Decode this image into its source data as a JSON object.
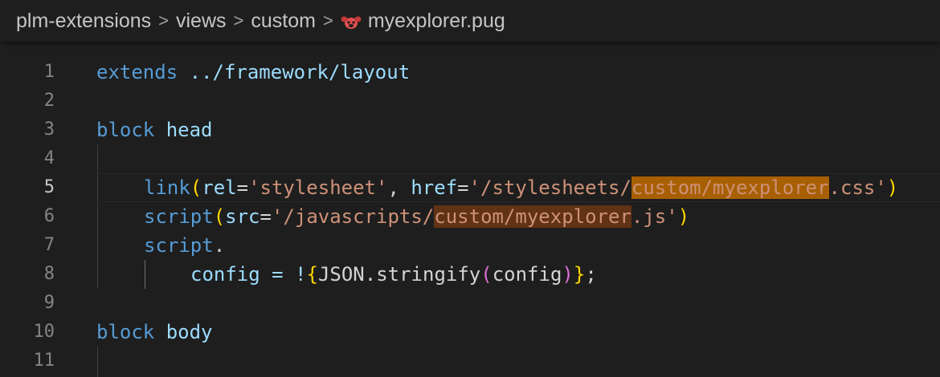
{
  "breadcrumb": {
    "items": [
      "plm-extensions",
      "views",
      "custom"
    ],
    "file": "myexplorer.pug",
    "separator": ">"
  },
  "editor": {
    "active_line": 5,
    "lines": [
      {
        "n": "1"
      },
      {
        "n": "2"
      },
      {
        "n": "3"
      },
      {
        "n": "4"
      },
      {
        "n": "5"
      },
      {
        "n": "6"
      },
      {
        "n": "7"
      },
      {
        "n": "8"
      },
      {
        "n": "9"
      },
      {
        "n": "10"
      },
      {
        "n": "11"
      }
    ],
    "code": {
      "l1_kw": "extends",
      "l1_path": " ../framework/layout",
      "l3_kw": "block",
      "l3_name": " head",
      "l5_tag": "link",
      "l5_a1": "rel",
      "l5_v1": "'stylesheet'",
      "l5_a2": "href",
      "l5_v2a": "'/stylesheets/",
      "l5_v2hl": "custom/myexplorer",
      "l5_v2b": ".css'",
      "l6_tag": "script",
      "l6_a1": "src",
      "l6_v1a": "'/javascripts/",
      "l6_v1hl": "custom/myexplorer",
      "l6_v1b": ".js'",
      "l7_tag": "script",
      "l8_code_a": "config = !",
      "l8_code_b": "JSON.stringify",
      "l8_code_c": "config",
      "l10_kw": "block",
      "l10_name": " body"
    }
  },
  "colors": {
    "background": "#1e1e1e",
    "keyword": "#569cd6",
    "string": "#ce9178",
    "selection_highlight": "#a85f00",
    "match_highlight": "#613214"
  },
  "icons": {
    "file_icon": "pug-icon"
  }
}
